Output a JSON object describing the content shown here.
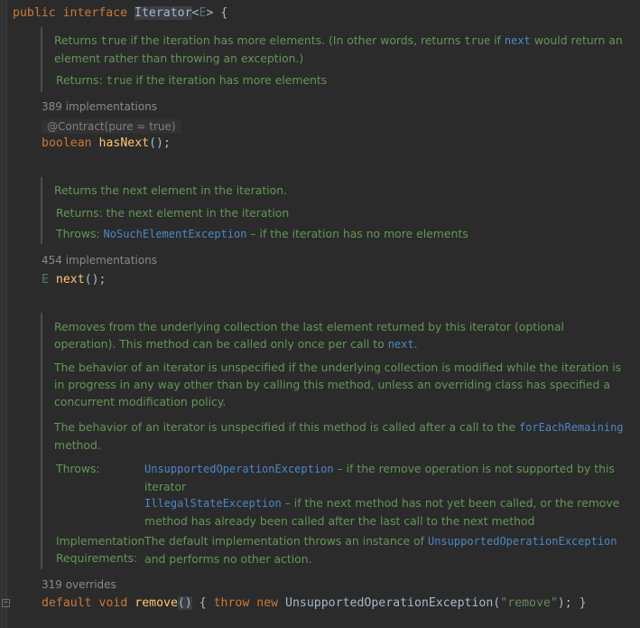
{
  "header": {
    "modifier": "public",
    "keyword": "interface",
    "name": "Iterator",
    "type_param_open": "<",
    "type_param": "E",
    "type_param_close": ">",
    "brace": " {"
  },
  "hasNext": {
    "doc_pre": "Returns ",
    "doc_code1": "true",
    "doc_mid1": " if the iteration has more elements. (In other words, returns ",
    "doc_code2": "true",
    "doc_mid2": " if ",
    "doc_link": "next",
    "doc_post": " would return an element rather than throwing an exception.)",
    "returns_pre": "Returns: ",
    "returns_code": "true",
    "returns_post": " if the iteration has more elements",
    "impl_count": "389 implementations",
    "annotation": "@Contract(pure = true)",
    "ret_type": "boolean",
    "name": "hasNext",
    "sig_rest": "();"
  },
  "next": {
    "doc": "Returns the next element in the iteration.",
    "returns": "Returns: the next element in the iteration",
    "throws_label": "Throws: ",
    "throws_link": "NoSuchElementException",
    "throws_text": " – if the iteration has no more elements",
    "impl_count": "454 implementations",
    "ret_type": "E",
    "name": "next",
    "sig_rest": "();"
  },
  "remove": {
    "p1_pre": "Removes from the underlying collection the last element returned by this iterator (optional operation). This method can be called only once per call to ",
    "p1_link": "next",
    "p1_post": ".",
    "p2": "The behavior of an iterator is unspecified if the underlying collection is modified while the iteration is in progress in any way other than by calling this method, unless an overriding class has specified a concurrent modification policy.",
    "p3_pre": "The behavior of an iterator is unspecified if this method is called after a call to the ",
    "p3_link": "forEachRemaining",
    "p3_post": " method.",
    "throws_label": "Throws:",
    "throws1_link": "UnsupportedOperationException",
    "throws1_text": " – if the remove operation is not supported by this iterator",
    "throws2_link": "IllegalStateException",
    "throws2_text": " – if the next method has not yet been called, or the remove method has already been called after the last call to the next method",
    "impl_label_1": "Implementation",
    "impl_label_2": "Requirements:",
    "impl_pre": "The default implementation throws an instance of ",
    "impl_link": "UnsupportedOperationException",
    "impl_post": " and performs no other action.",
    "overrides": "319 overrides",
    "kw_default": "default",
    "kw_void": "void",
    "name": "remove",
    "parens": "()",
    "brace_open": " { ",
    "kw_throw": "throw",
    "kw_new": "new",
    "exc": "UnsupportedOperationException",
    "paren_open": "(",
    "str": "\"remove\"",
    "paren_close": ");",
    "brace_close": " }"
  },
  "gutter": {
    "fold_icon": "fold-icon"
  }
}
